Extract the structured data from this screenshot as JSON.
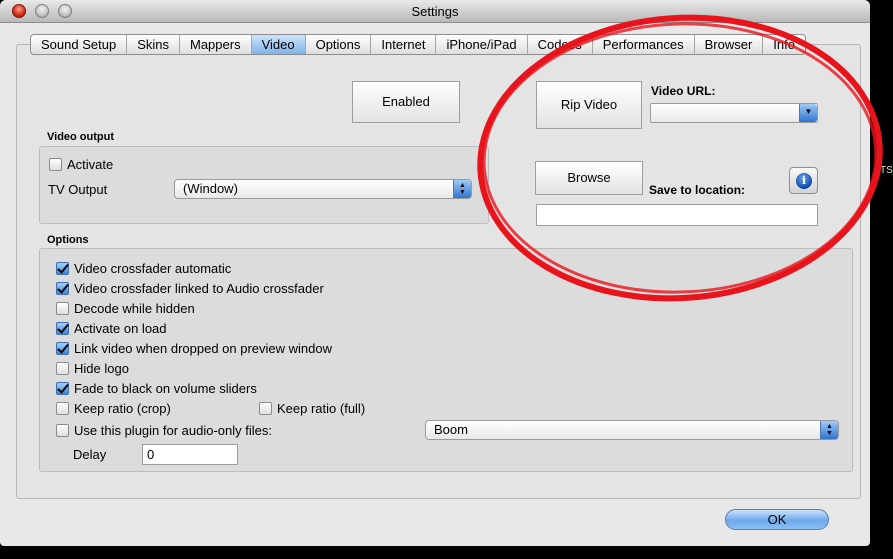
{
  "window": {
    "title": "Settings"
  },
  "tabs": [
    {
      "label": "Sound Setup",
      "active": false
    },
    {
      "label": "Skins",
      "active": false
    },
    {
      "label": "Mappers",
      "active": false
    },
    {
      "label": "Video",
      "active": true
    },
    {
      "label": "Options",
      "active": false
    },
    {
      "label": "Internet",
      "active": false
    },
    {
      "label": "iPhone/iPad",
      "active": false
    },
    {
      "label": "Codecs",
      "active": false
    },
    {
      "label": "Performances",
      "active": false
    },
    {
      "label": "Browser",
      "active": false
    },
    {
      "label": "Info",
      "active": false
    }
  ],
  "video": {
    "enabled_button": "Enabled",
    "output_group_label": "Video output",
    "activate_label": "Activate",
    "activate_checked": false,
    "tv_output_label": "TV Output",
    "tv_output_value": "(Window)",
    "rip_video_button": "Rip Video",
    "video_url_label": "Video URL:",
    "video_url_value": "",
    "browse_button": "Browse",
    "save_location_label": "Save to location:",
    "save_location_value": ""
  },
  "options": {
    "group_label": "Options",
    "items": [
      {
        "label": "Video crossfader automatic",
        "checked": true
      },
      {
        "label": "Video crossfader linked to Audio crossfader",
        "checked": true
      },
      {
        "label": "Decode while hidden",
        "checked": false
      },
      {
        "label": "Activate on load",
        "checked": true
      },
      {
        "label": "Link video when dropped on preview window",
        "checked": true
      },
      {
        "label": "Hide logo",
        "checked": false
      },
      {
        "label": "Fade to black on volume sliders",
        "checked": true
      }
    ],
    "keep_ratio_crop": {
      "label": "Keep ratio (crop)",
      "checked": false
    },
    "keep_ratio_full": {
      "label": "Keep ratio (full)",
      "checked": false
    },
    "audio_only_plugin": {
      "label": "Use this plugin for audio-only files:",
      "checked": false
    },
    "plugin_value": "Boom",
    "delay_label": "Delay",
    "delay_value": "0"
  },
  "ok_button": "OK",
  "icons": {
    "info": "info-icon",
    "popup_arrows": "up-down-arrows-icon",
    "dropdown_arrow": "chevron-down-icon"
  },
  "colors": {
    "annotation_circle": "#e8141c",
    "accent_blue": "#3a84d6"
  }
}
